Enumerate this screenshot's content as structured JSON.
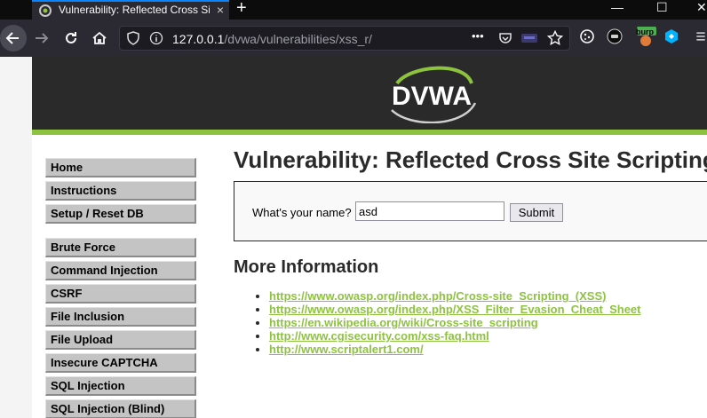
{
  "browser": {
    "tab_title": "Vulnerability: Reflected Cross Site Scripting (XSS)",
    "tab_close": "×",
    "new_tab": "+",
    "url_host": "127.0.0.1",
    "url_path": "/dvwa/vulnerabilities/xss_r/",
    "more_actions": "•••",
    "window_minimize": "—",
    "window_maximize": "☐",
    "window_close": "✕",
    "burp_badge": "burp",
    "accent": "#0a84ff"
  },
  "site": {
    "logo_text": "DVWA",
    "accent": "#8dc33f"
  },
  "menu": {
    "groups": [
      [
        "Home",
        "Instructions",
        "Setup / Reset DB"
      ],
      [
        "Brute Force",
        "Command Injection",
        "CSRF",
        "File Inclusion",
        "File Upload",
        "Insecure CAPTCHA",
        "SQL Injection",
        "SQL Injection (Blind)"
      ]
    ]
  },
  "main": {
    "title": "Vulnerability: Reflected Cross Site Scripting (XSS)",
    "form": {
      "label": "What's your name?",
      "value": "asd",
      "submit_label": "Submit"
    },
    "more_info_title": "More Information",
    "links": [
      "https://www.owasp.org/index.php/Cross-site_Scripting_(XSS)",
      "https://www.owasp.org/index.php/XSS_Filter_Evasion_Cheat_Sheet",
      "https://en.wikipedia.org/wiki/Cross-site_scripting",
      "http://www.cgisecurity.com/xss-faq.html",
      "http://www.scriptalert1.com/"
    ]
  }
}
